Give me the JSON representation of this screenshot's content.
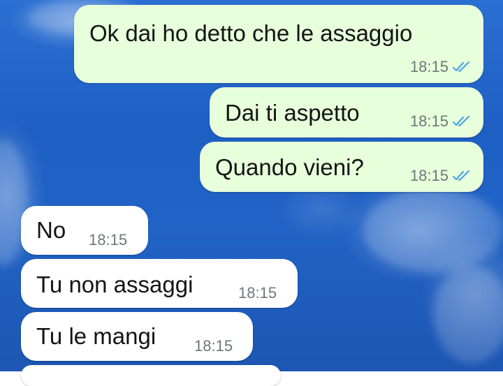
{
  "chat": {
    "messages": [
      {
        "direction": "outgoing",
        "text": "Ok dai ho detto che le assaggio",
        "time": "18:15",
        "status_icon": "double-check-read-icon"
      },
      {
        "direction": "outgoing",
        "text": "Dai ti aspetto",
        "time": "18:15",
        "status_icon": "double-check-read-icon"
      },
      {
        "direction": "outgoing",
        "text": "Quando vieni?",
        "time": "18:15",
        "status_icon": "double-check-read-icon"
      },
      {
        "direction": "incoming",
        "text": "No",
        "time": "18:15"
      },
      {
        "direction": "incoming",
        "text": "Tu non assaggi",
        "time": "18:15"
      },
      {
        "direction": "incoming",
        "text": "Tu le mangi",
        "time": "18:15"
      }
    ]
  },
  "colors": {
    "outgoing_bubble": "#e7ffdb",
    "incoming_bubble": "#ffffff",
    "read_tick": "#4fa3e8",
    "time_text": "#6a7a78",
    "wallpaper_sky": "#2163c6"
  }
}
